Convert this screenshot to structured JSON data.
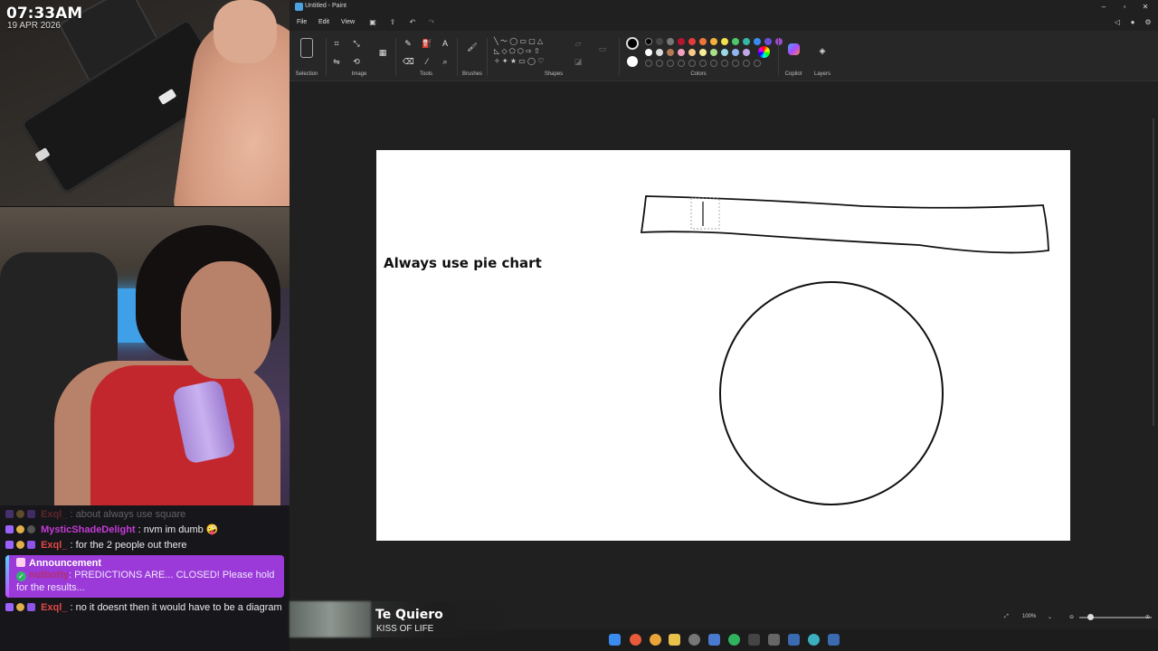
{
  "overlay": {
    "clock_time": "07:33AM",
    "clock_date": "19 APR 2026"
  },
  "chat": {
    "messages": [
      {
        "user": "Exql_",
        "text": "about always use square",
        "user_color": "#e04848",
        "faded": true
      },
      {
        "user": "MysticShadeDelight",
        "text": "nvm im dumb 🤪",
        "user_color": "#c43cd6",
        "faded": false
      },
      {
        "user": "Exql_",
        "text": "for the 2 people out there",
        "user_color": "#e04848",
        "faded": false
      }
    ],
    "announcement": {
      "title": "Announcement",
      "user": "nutbotty",
      "user_color": "#b3306f",
      "text": "PREDICTIONS ARE... CLOSED! Please hold for the results..."
    },
    "last_message": {
      "user": "Exql_",
      "text": "no it doesnt then it would have to be a diagram",
      "user_color": "#e04848"
    }
  },
  "now_playing": {
    "title": "Te Quiero",
    "artist": "KISS OF LIFE"
  },
  "paint": {
    "window_title": "Untitled - Paint",
    "menu": {
      "file": "File",
      "edit": "Edit",
      "view": "View"
    },
    "ribbon": {
      "selection": "Selection",
      "image": "Image",
      "tools": "Tools",
      "brushes": "Brushes",
      "shapes": "Shapes",
      "colors": "Colors",
      "copilot": "Copilot",
      "layers": "Layers"
    },
    "palette_row1": [
      "#000000",
      "#464646",
      "#787878",
      "#b5152e",
      "#e83b3b",
      "#f0753a",
      "#f5b03a",
      "#f4e04a",
      "#4cc86a",
      "#36b6a4",
      "#3a8cf0",
      "#6a50d8",
      "#a04ad0"
    ],
    "palette_row2": [
      "#ffffff",
      "#dcdcdc",
      "#b47854",
      "#f4a0c0",
      "#f7c98a",
      "#f6ec9a",
      "#a8e08a",
      "#9ad8e6",
      "#90b4f0",
      "#c0a8e8"
    ],
    "primary_color": "#000000",
    "secondary_color": "#ffffff",
    "canvas_text": "Always use pie chart",
    "zoom": "100%"
  }
}
